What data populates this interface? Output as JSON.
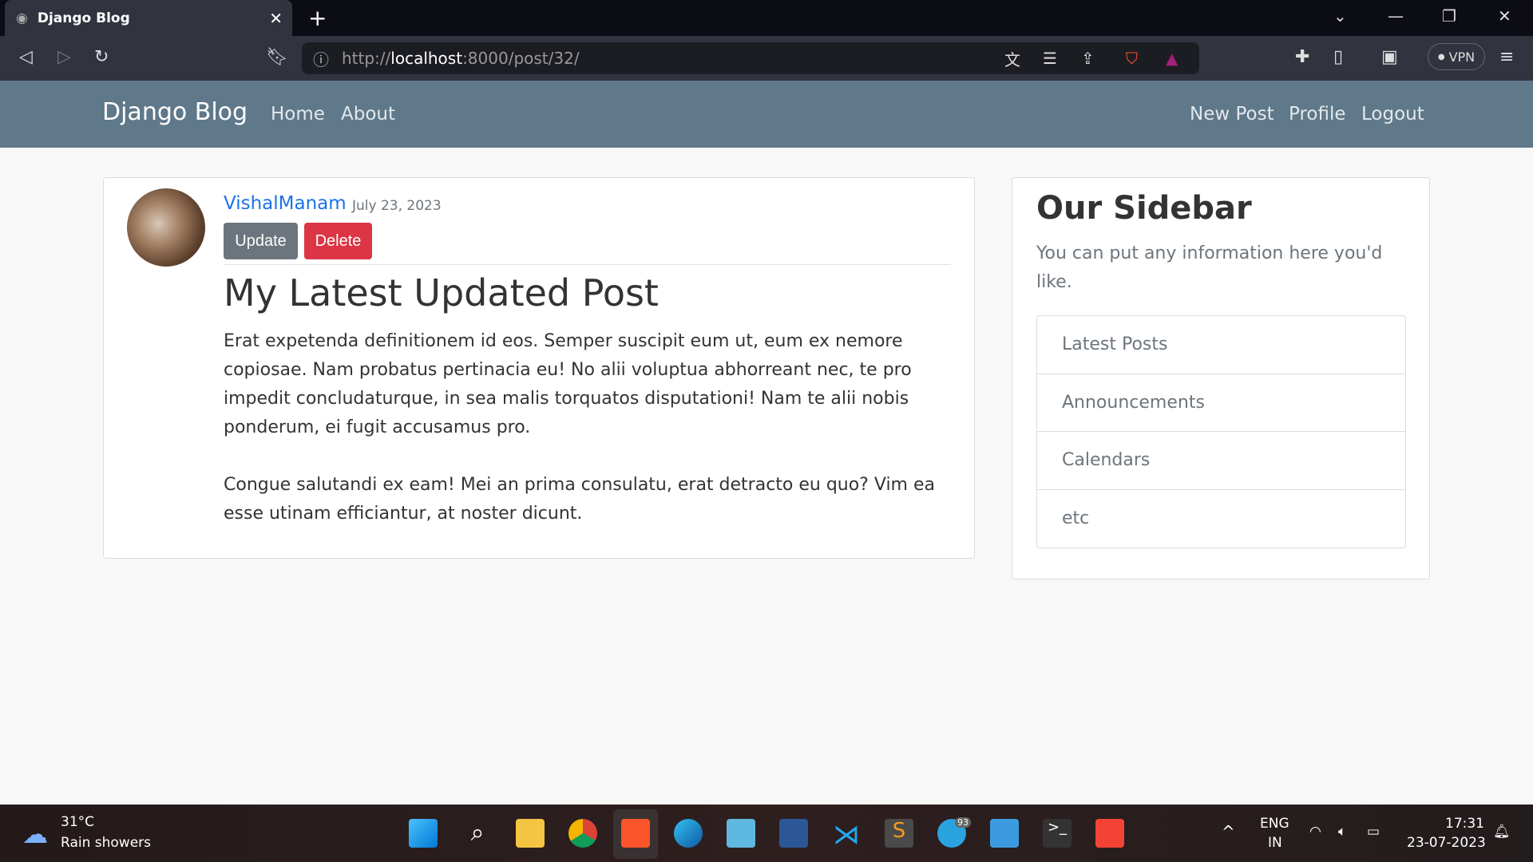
{
  "browser": {
    "tab_title": "Django Blog",
    "url_prefix": "http://",
    "url_host": "localhost",
    "url_rest": ":8000/post/32/",
    "vpn_label": "VPN"
  },
  "navbar": {
    "brand": "Django Blog",
    "left_links": [
      "Home",
      "About"
    ],
    "right_links": [
      "New Post",
      "Profile",
      "Logout"
    ]
  },
  "post": {
    "author": "VishalManam",
    "date": "July 23, 2023",
    "update_label": "Update",
    "delete_label": "Delete",
    "title": "My Latest Updated Post",
    "paragraphs": [
      "Erat expetenda definitionem id eos. Semper suscipit eum ut, eum ex nemore copiosae. Nam probatus pertinacia eu! No alii voluptua abhorreant nec, te pro impedit concludaturque, in sea malis torquatos disputationi! Nam te alii nobis ponderum, ei fugit accusamus pro.",
      "Congue salutandi ex eam! Mei an prima consulatu, erat detracto eu quo? Vim ea esse utinam efficiantur, at noster dicunt."
    ]
  },
  "sidebar": {
    "title": "Our Sidebar",
    "text": "You can put any information here you'd like.",
    "items": [
      "Latest Posts",
      "Announcements",
      "Calendars",
      "etc"
    ]
  },
  "taskbar": {
    "temp": "31°C",
    "weather": "Rain showers",
    "lang1": "ENG",
    "lang2": "IN",
    "time": "17:31",
    "date": "23-07-2023",
    "telegram_badge": "93"
  },
  "colors": {
    "navbar": "#5f788a",
    "update_btn": "#6c757d",
    "delete_btn": "#dc3545",
    "link": "#1a73e8"
  }
}
